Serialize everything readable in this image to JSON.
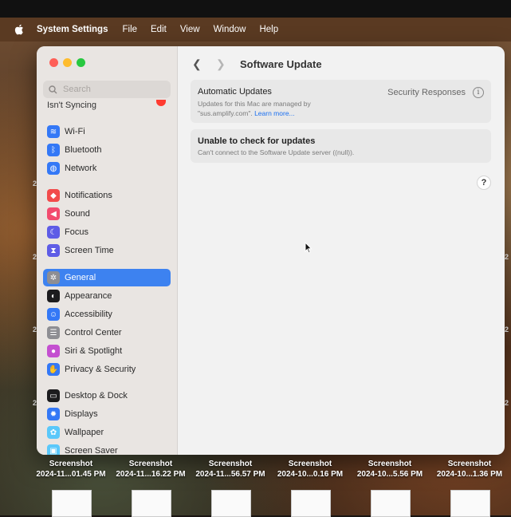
{
  "menubar": {
    "app_name": "System Settings",
    "items": [
      "File",
      "Edit",
      "View",
      "Window",
      "Help"
    ]
  },
  "sidebar": {
    "search_placeholder": "Search",
    "cutoff_label": "Isn't Syncing",
    "items": [
      {
        "label": "Wi-Fi",
        "icon": "wifi-icon",
        "color": "#3478f6"
      },
      {
        "label": "Bluetooth",
        "icon": "bluetooth-icon",
        "color": "#3478f6"
      },
      {
        "label": "Network",
        "icon": "globe-icon",
        "color": "#3478f6"
      },
      {
        "label": "Notifications",
        "icon": "bell-icon",
        "color": "#f24b4b"
      },
      {
        "label": "Sound",
        "icon": "speaker-icon",
        "color": "#f24b6e"
      },
      {
        "label": "Focus",
        "icon": "moon-icon",
        "color": "#5e5ce6"
      },
      {
        "label": "Screen Time",
        "icon": "hourglass-icon",
        "color": "#5e5ce6"
      },
      {
        "label": "General",
        "icon": "gear-icon",
        "color": "#8e8e93",
        "selected": true
      },
      {
        "label": "Appearance",
        "icon": "appearance-icon",
        "color": "#1c1c1e"
      },
      {
        "label": "Accessibility",
        "icon": "accessibility-icon",
        "color": "#3478f6"
      },
      {
        "label": "Control Center",
        "icon": "control-center-icon",
        "color": "#8e8e93"
      },
      {
        "label": "Siri & Spotlight",
        "icon": "siri-icon",
        "color": "#c44fd0"
      },
      {
        "label": "Privacy & Security",
        "icon": "hand-icon",
        "color": "#3478f6"
      },
      {
        "label": "Desktop & Dock",
        "icon": "dock-icon",
        "color": "#1c1c1e"
      },
      {
        "label": "Displays",
        "icon": "sun-icon",
        "color": "#3478f6"
      },
      {
        "label": "Wallpaper",
        "icon": "flower-icon",
        "color": "#5ac8fa"
      },
      {
        "label": "Screen Saver",
        "icon": "screensaver-icon",
        "color": "#5ac8fa"
      }
    ]
  },
  "main": {
    "title": "Software Update",
    "auto_updates": {
      "title": "Automatic Updates",
      "line1": "Updates for this Mac are managed by",
      "line2": "\"sus.amplify.com\".",
      "link": "Learn more...",
      "right_label": "Security Responses"
    },
    "error": {
      "title": "Unable to check for updates",
      "message": "Can't connect to the Software Update server ((null))."
    },
    "help": "?"
  },
  "desktop": {
    "items": [
      {
        "line1": "Screenshot",
        "line2": "2024-11...01.45 PM"
      },
      {
        "line1": "Screenshot",
        "line2": "2024-11...16.22 PM"
      },
      {
        "line1": "Screenshot",
        "line2": "2024-11...56.57 PM"
      },
      {
        "line1": "Screenshot",
        "line2": "2024-10...0.16 PM"
      },
      {
        "line1": "Screenshot",
        "line2": "2024-10...5.56 PM"
      },
      {
        "line1": "Screenshot",
        "line2": "2024-10...1.36 PM"
      }
    ],
    "left_fragments": [
      "2",
      "2",
      "2",
      "2",
      "2",
      "2"
    ],
    "right_fragments": [
      "2",
      "2",
      "2"
    ]
  }
}
